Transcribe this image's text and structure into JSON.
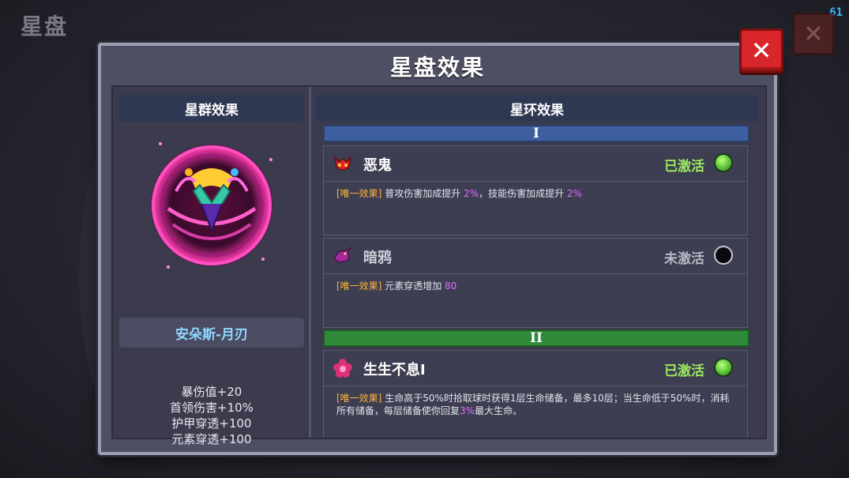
{
  "screen": {
    "bg_title": "星盘",
    "fps": "61"
  },
  "panel": {
    "title": "星盘效果",
    "close_symbol": "✕"
  },
  "left": {
    "header": "星群效果",
    "constellation_name": "安朵斯-月刃",
    "stats": [
      "暴伤值+20",
      "首领伤害+10%",
      "护甲穿透+100",
      "元素穿透+100"
    ]
  },
  "right": {
    "header": "星环效果",
    "tiers": [
      {
        "label": "I",
        "color": "#3f5fa0"
      },
      {
        "label": "II",
        "color": "#2f8a3a"
      }
    ],
    "cards": [
      {
        "icon": "demon-icon",
        "name": "恶鬼",
        "status": "已激活",
        "active": true,
        "desc": {
          "tag": "[唯一效果]",
          "parts": [
            "普攻伤害加成提升 ",
            "2%",
            "，技能伤害加成提升 ",
            "2%"
          ]
        }
      },
      {
        "icon": "raven-icon",
        "name": "暗鸦",
        "status": "未激活",
        "active": false,
        "desc": {
          "tag": "[唯一效果]",
          "parts": [
            "元素穿透增加 ",
            "80"
          ]
        }
      },
      {
        "icon": "flower-icon",
        "name": "生生不息Ⅰ",
        "status": "已激活",
        "active": true,
        "desc": {
          "tag": "[唯一效果]",
          "parts": [
            "生命高于50%时拾取球时获得1层生命储备，最多10层；当生命低于50%时，消耗所有储备，每层储备使你回复",
            "3%",
            "最大生命。"
          ]
        }
      }
    ]
  },
  "colors": {
    "active_status": "#9cea5e",
    "inactive_status": "#b8b8c6",
    "tag": "#ffb43a",
    "highlight": "#e06cff",
    "name_box": "#8fd7ff"
  }
}
